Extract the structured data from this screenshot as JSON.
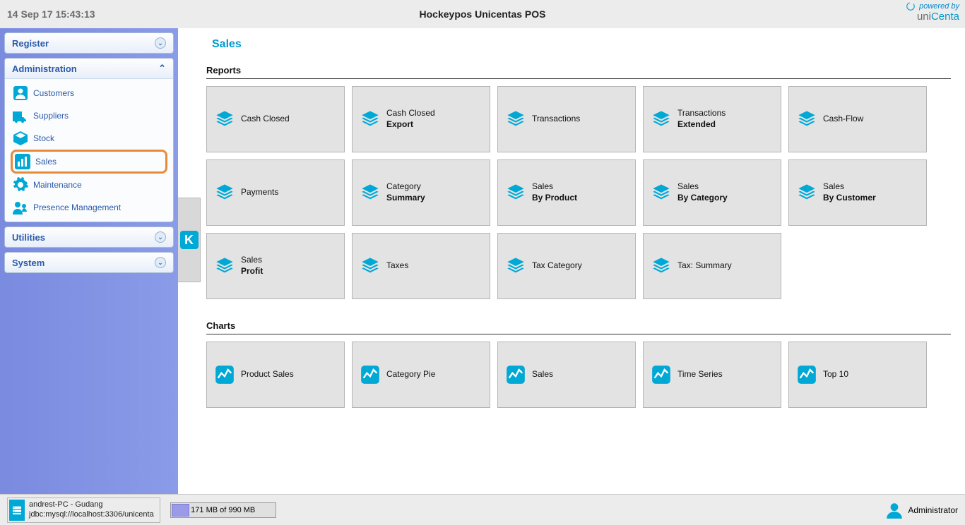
{
  "header": {
    "timestamp": "14 Sep 17 15:43:13",
    "title": "Hockeypos Unicentas POS",
    "powered_label": "powered by",
    "brand_prefix": "uni",
    "brand_suffix": "Centa"
  },
  "sidebar": {
    "headers": {
      "register": "Register",
      "utilities": "Utilities",
      "system": "System"
    },
    "admin": {
      "title": "Administration",
      "items": [
        {
          "label": "Customers"
        },
        {
          "label": "Suppliers"
        },
        {
          "label": "Stock"
        },
        {
          "label": "Sales"
        },
        {
          "label": "Maintenance"
        },
        {
          "label": "Presence Management"
        }
      ]
    }
  },
  "content": {
    "page_title": "Sales",
    "groups": [
      {
        "title": "Reports",
        "icon": "stack",
        "tiles": [
          {
            "line1": "Cash Closed",
            "line2": ""
          },
          {
            "line1": "Cash Closed",
            "line2": "Export"
          },
          {
            "line1": "Transactions",
            "line2": ""
          },
          {
            "line1": "Transactions",
            "line2": "Extended"
          },
          {
            "line1": "Cash-Flow",
            "line2": ""
          },
          {
            "line1": "Payments",
            "line2": ""
          },
          {
            "line1": "Category",
            "line2": "Summary"
          },
          {
            "line1": "Sales",
            "line2": "By Product"
          },
          {
            "line1": "Sales",
            "line2": "By Category"
          },
          {
            "line1": "Sales",
            "line2": "By Customer"
          },
          {
            "line1": "Sales",
            "line2": "Profit"
          },
          {
            "line1": "Taxes",
            "line2": ""
          },
          {
            "line1": "Tax Category",
            "line2": ""
          },
          {
            "line1": "Tax: Summary",
            "line2": ""
          }
        ]
      },
      {
        "title": "Charts",
        "icon": "chart",
        "tiles": [
          {
            "line1": "Product Sales",
            "line2": ""
          },
          {
            "line1": "Category Pie",
            "line2": ""
          },
          {
            "line1": "Sales",
            "line2": ""
          },
          {
            "line1": "Time Series",
            "line2": ""
          },
          {
            "line1": "Top 10",
            "line2": ""
          }
        ]
      }
    ]
  },
  "footer": {
    "host": "andrest-PC - Gudang",
    "jdbc": "jdbc:mysql://localhost:3306/unicenta",
    "memory": "171 MB of 990 MB",
    "user_label": "Administrator"
  }
}
